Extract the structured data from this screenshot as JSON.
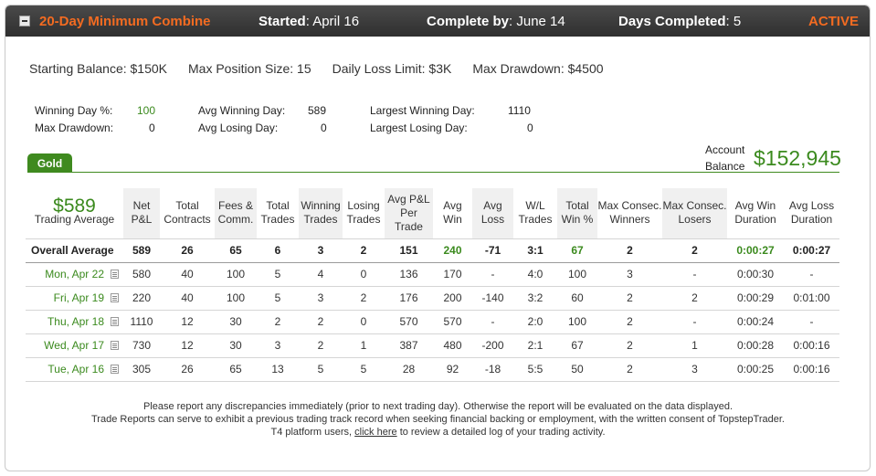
{
  "header": {
    "title": "20-Day Minimum Combine",
    "started_label": "Started",
    "started_value": "April 16",
    "complete_label": "Complete by",
    "complete_value": "June 14",
    "days_label": "Days Completed",
    "days_value": "5",
    "status": "ACTIVE"
  },
  "rules": {
    "starting_balance": "Starting Balance: $150K",
    "max_position": "Max Position Size: 15",
    "daily_loss": "Daily Loss Limit: $3K",
    "max_drawdown": "Max Drawdown: $4500"
  },
  "stats": {
    "winning_day_pct_label": "Winning Day %:",
    "winning_day_pct": "100",
    "max_drawdown_label": "Max Drawdown:",
    "max_drawdown": "0",
    "avg_winning_day_label": "Avg Winning Day:",
    "avg_winning_day": "589",
    "avg_losing_day_label": "Avg Losing Day:",
    "avg_losing_day": "0",
    "largest_winning_day_label": "Largest Winning Day:",
    "largest_winning_day": "1110",
    "largest_losing_day_label": "Largest Losing Day:",
    "largest_losing_day": "0"
  },
  "tab": {
    "label": "Gold"
  },
  "account": {
    "label_line1": "Account",
    "label_line2": "Balance",
    "value": "$152,945"
  },
  "table": {
    "summary_value": "$589",
    "summary_label": "Trading Average",
    "headers": [
      [
        "Net",
        "P&L"
      ],
      [
        "Total",
        "Contracts"
      ],
      [
        "Fees &",
        "Comm."
      ],
      [
        "Total",
        "Trades"
      ],
      [
        "Winning",
        "Trades"
      ],
      [
        "Losing",
        "Trades"
      ],
      [
        "Avg P&L",
        "Per",
        "Trade"
      ],
      [
        "Avg",
        "Win"
      ],
      [
        "Avg",
        "Loss"
      ],
      [
        "W/L",
        "Trades"
      ],
      [
        "Total",
        "Win %"
      ],
      [
        "Max Consec.",
        "Winners"
      ],
      [
        "Max Consec.",
        "Losers"
      ],
      [
        "Avg Win",
        "Duration"
      ],
      [
        "Avg Loss",
        "Duration"
      ]
    ],
    "overall": {
      "label": "Overall Average",
      "values": [
        "589",
        "26",
        "65",
        "6",
        "3",
        "2",
        "151",
        "240",
        "-71",
        "3:1",
        "67",
        "2",
        "2",
        "0:00:27",
        "0:00:27"
      ]
    },
    "rows": [
      {
        "date": "Mon, Apr 22",
        "values": [
          "580",
          "40",
          "100",
          "5",
          "4",
          "0",
          "136",
          "170",
          "-",
          "4:0",
          "100",
          "3",
          "-",
          "0:00:30",
          "-"
        ]
      },
      {
        "date": "Fri, Apr 19",
        "values": [
          "220",
          "40",
          "100",
          "5",
          "3",
          "2",
          "176",
          "200",
          "-140",
          "3:2",
          "60",
          "2",
          "2",
          "0:00:29",
          "0:01:00"
        ]
      },
      {
        "date": "Thu, Apr 18",
        "values": [
          "1110",
          "12",
          "30",
          "2",
          "2",
          "0",
          "570",
          "570",
          "-",
          "2:0",
          "100",
          "2",
          "-",
          "0:00:24",
          "-"
        ]
      },
      {
        "date": "Wed, Apr 17",
        "values": [
          "730",
          "12",
          "30",
          "3",
          "2",
          "1",
          "387",
          "480",
          "-200",
          "2:1",
          "67",
          "2",
          "1",
          "0:00:28",
          "0:00:16"
        ]
      },
      {
        "date": "Tue, Apr 16",
        "values": [
          "305",
          "26",
          "65",
          "13",
          "5",
          "5",
          "28",
          "92",
          "-18",
          "5:5",
          "50",
          "2",
          "3",
          "0:00:25",
          "0:00:16"
        ]
      }
    ]
  },
  "footer": {
    "line1": "Please report any discrepancies immediately (prior to next trading day). Otherwise the report will be evaluated on the data displayed.",
    "line2": "Trade Reports can serve to exhibit a previous trading track record when seeking financial backing or employment, with the written consent of TopstepTrader.",
    "line3_prefix": "T4 platform users,",
    "line3_link": "click here",
    "line3_suffix": "to review a detailed log of your trading activity."
  }
}
